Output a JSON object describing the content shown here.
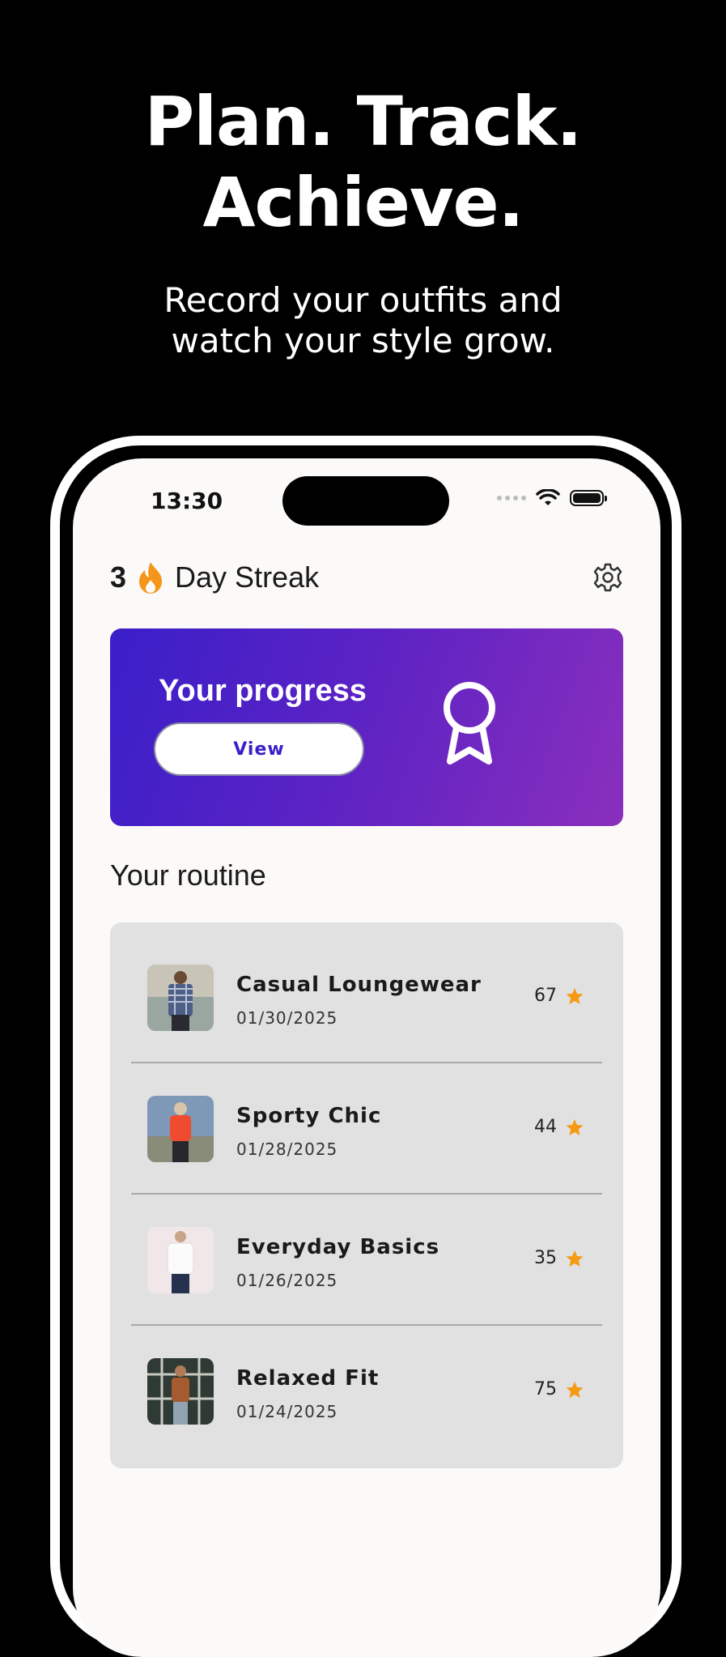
{
  "hero": {
    "line1": "Plan. Track.",
    "line2": "Achieve.",
    "sub1": "Record your outfits and",
    "sub2": "watch your style grow."
  },
  "status_bar": {
    "time": "13:30"
  },
  "header": {
    "streak_count": "3",
    "streak_label": "Day Streak",
    "settings_icon": "gear-icon"
  },
  "progress_card": {
    "title": "Your progress",
    "button_label": "View",
    "icon": "award-ribbon-icon"
  },
  "routine": {
    "title": "Your routine",
    "items": [
      {
        "name": "Casual Loungewear",
        "date": "01/30/2025",
        "score": "67"
      },
      {
        "name": "Sporty Chic",
        "date": "01/28/2025",
        "score": "44"
      },
      {
        "name": "Everyday Basics",
        "date": "01/26/2025",
        "score": "35"
      },
      {
        "name": "Relaxed Fit",
        "date": "01/24/2025",
        "score": "75"
      }
    ]
  },
  "colors": {
    "accent_start": "#3a1fc9",
    "accent_end": "#8a2fbd",
    "star": "#f59a12",
    "flame": "#f5961a"
  }
}
